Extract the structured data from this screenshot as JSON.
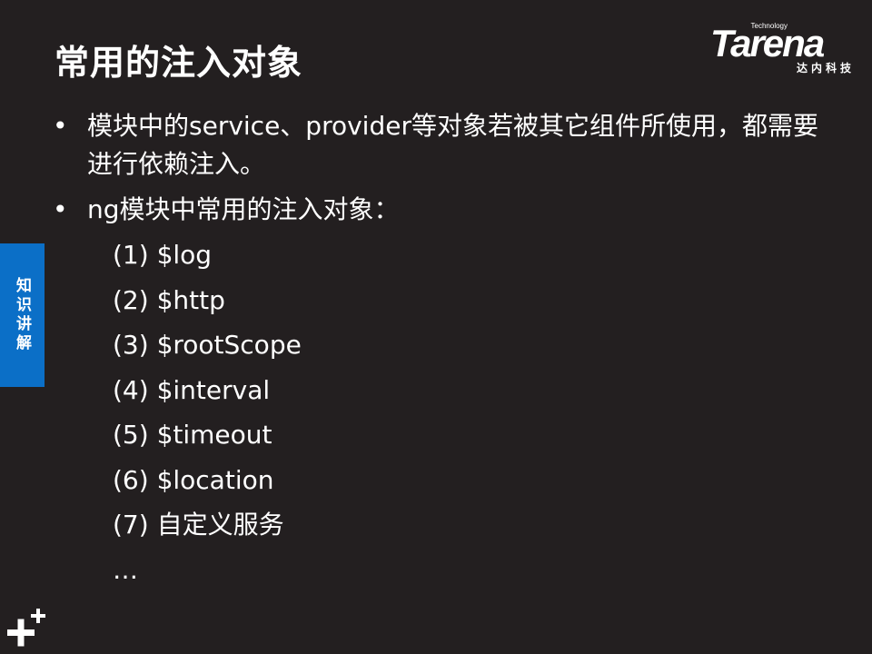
{
  "slide": {
    "title": "常用的注入对象",
    "logo": {
      "tagline": "Technology",
      "wordmark": "Tarena",
      "chinese": "达内科技"
    },
    "side_tab": "知识讲解",
    "bullets": [
      {
        "marker": "•",
        "text": "模块中的service、provider等对象若被其它组件所使用，都需要进行依赖注入。"
      },
      {
        "marker": "•",
        "text": "ng模块中常用的注入对象："
      }
    ],
    "list_items": [
      "(1) $log",
      "(2) $http",
      "(3) $rootScope",
      "(4) $interval",
      "(5) $timeout",
      "(6) $location",
      "(7)  自定义服务",
      "…"
    ],
    "corner_icon": "plus-icon"
  }
}
